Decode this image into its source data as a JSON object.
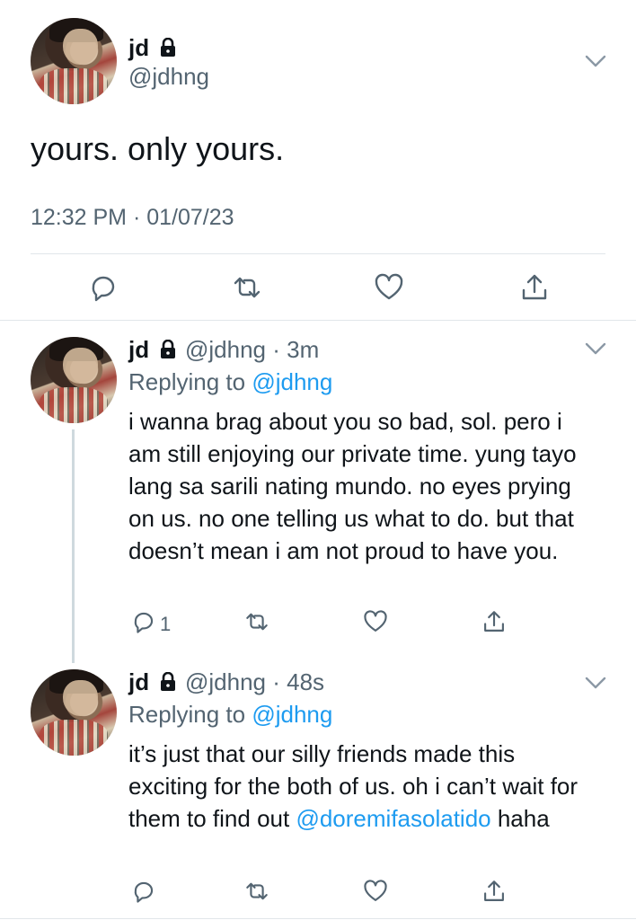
{
  "main_tweet": {
    "name": "jd",
    "handle": "@jdhng",
    "text": "yours. only yours.",
    "timestamp": "12:32 PM · 01/07/23"
  },
  "replies": [
    {
      "name": "jd",
      "handle_time": "@jdhng · 3m",
      "replying_prefix": "Replying to ",
      "replying_to": "@jdhng",
      "text": "i wanna brag about you so bad, sol. pero i am still enjoying our private time. yung tayo lang sa sarili nating mundo. no eyes prying on us. no one telling us what to do. but that doesn’t mean i am not proud to have you.",
      "reply_count": "1"
    },
    {
      "name": "jd",
      "handle_time": "@jdhng · 48s",
      "replying_prefix": "Replying to ",
      "replying_to": "@jdhng",
      "text_before_mention": "it’s just that our silly friends made this exciting for the both of us. oh i can’t wait for them to find out ",
      "mention": "@doremifasolatido",
      "text_after_mention": " haha"
    }
  ],
  "icons": {
    "lock": "lock-icon",
    "chevron": "chevron-down-icon",
    "reply": "reply-icon",
    "retweet": "retweet-icon",
    "like": "heart-icon",
    "share": "share-icon"
  },
  "colors": {
    "text": "#0f1419",
    "secondary": "#536471",
    "link": "#1d9bf0",
    "divider": "#e1e6ea"
  }
}
